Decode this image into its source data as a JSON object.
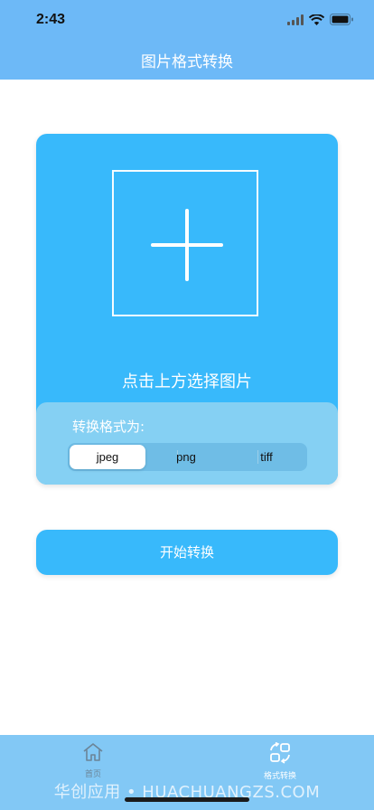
{
  "status_bar": {
    "time": "2:43"
  },
  "nav": {
    "title": "图片格式转换"
  },
  "card": {
    "pick_text": "点击上方选择图片",
    "format_label": "转换格式为:",
    "formats": [
      "jpeg",
      "png",
      "tiff"
    ],
    "selected_format": "jpeg"
  },
  "start_button": {
    "label": "开始转换"
  },
  "tabbar": {
    "tabs": [
      {
        "label": "首页",
        "icon": "home-icon",
        "active": false
      },
      {
        "label": "格式转换",
        "icon": "convert-icon",
        "active": true
      }
    ]
  },
  "watermark": "华创应用 • HUACHUANGZS.COM",
  "colors": {
    "header": "#6db9f7",
    "accent": "#38b9fb",
    "panel": "#85d0f3",
    "tabbar": "#82c8f5"
  }
}
